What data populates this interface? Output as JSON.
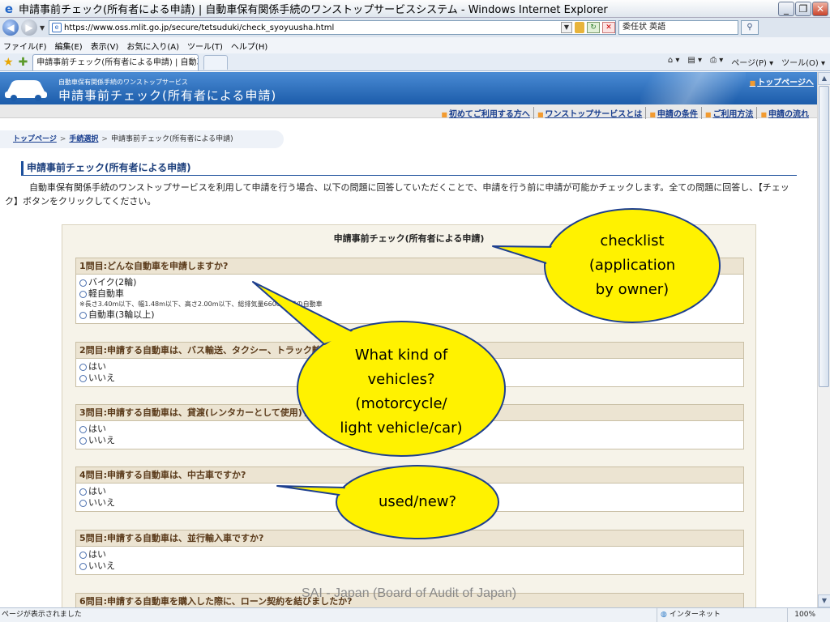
{
  "window": {
    "title": "申請事前チェック(所有者による申請) | 自動車保有関係手続のワンストップサービスシステム - Windows Internet Explorer",
    "minimize_label": "_",
    "maximize_label": "❐",
    "close_label": "✕"
  },
  "addressbar": {
    "url": "https://www.oss.mlit.go.jp/secure/tetsuduki/check_syoyuusha.html",
    "search_value": "委任状 英語"
  },
  "menu": {
    "items": [
      "ファイル(F)",
      "編集(E)",
      "表示(V)",
      "お気に入り(A)",
      "ツール(T)",
      "ヘルプ(H)"
    ]
  },
  "tabbar": {
    "tab_label": "申請事前チェック(所有者による申請) | 自動車...",
    "commands": [
      "ページ(P) ▾",
      "ツール(O) ▾"
    ]
  },
  "site": {
    "subtitle": "自動車保有関係手続のワンストップサービス",
    "title": "申請事前チェック(所有者による申請)",
    "top_link": "トップページへ",
    "subnav": [
      "初めてご利用する方へ",
      "ワンストップサービスとは",
      "申請の条件",
      "ご利用方法",
      "申請の流れ"
    ],
    "breadcrumb": {
      "home": "トップページ",
      "step": "手続選択",
      "current": "申請事前チェック(所有者による申請)"
    },
    "heading": "申請事前チェック(所有者による申請)",
    "intro": "自動車保有関係手続のワンストップサービスを利用して申請を行う場合、以下の問題に回答していただくことで、申請を行う前に申請が可能かチェックします。全ての問題に回答し、【チェック】ボタンをクリックしてください。"
  },
  "form": {
    "title": "申請事前チェック(所有者による申請)",
    "questions": [
      {
        "label": "1問目:どんな自動車を申請しますか?",
        "options": [
          "バイク(2輪)",
          "軽自動車",
          "自動車(3輪以上)"
        ],
        "note": "※長さ3.40m以下、幅1.48m以下、高さ2.00m以下、総排気量660cc以下の自動車"
      },
      {
        "label": "2問目:申請する自動車は、バス輸送、タクシー、トラック輸送に使用する自動車ですか?",
        "options": [
          "はい",
          "いいえ"
        ]
      },
      {
        "label": "3問目:申請する自動車は、貸渡(レンタカーとして使用)する自動車ですか?",
        "options": [
          "はい",
          "いいえ"
        ]
      },
      {
        "label": "4問目:申請する自動車は、中古車ですか?",
        "options": [
          "はい",
          "いいえ"
        ]
      },
      {
        "label": "5問目:申請する自動車は、並行輸入車ですか?",
        "options": [
          "はい",
          "いいえ"
        ]
      },
      {
        "label": "6問目:申請する自動車を購入した際に、ローン契約を結びましたか?"
      }
    ]
  },
  "callouts": {
    "checklist": [
      "checklist",
      "(application",
      "by owner)"
    ],
    "vehicles": [
      "What kind of",
      "vehicles?",
      "(motorcycle/",
      "light vehicle/car)"
    ],
    "used": [
      "used/new?"
    ]
  },
  "watermark": "SAI - Japan (Board of Audit of Japan)",
  "statusbar": {
    "text": "ページが表示されました",
    "zone": "インターネット",
    "zoom": "100%"
  },
  "colors": {
    "header_blue": "#1c5caa",
    "callout_fill": "#fff200",
    "accent_orange": "#f29b30"
  }
}
